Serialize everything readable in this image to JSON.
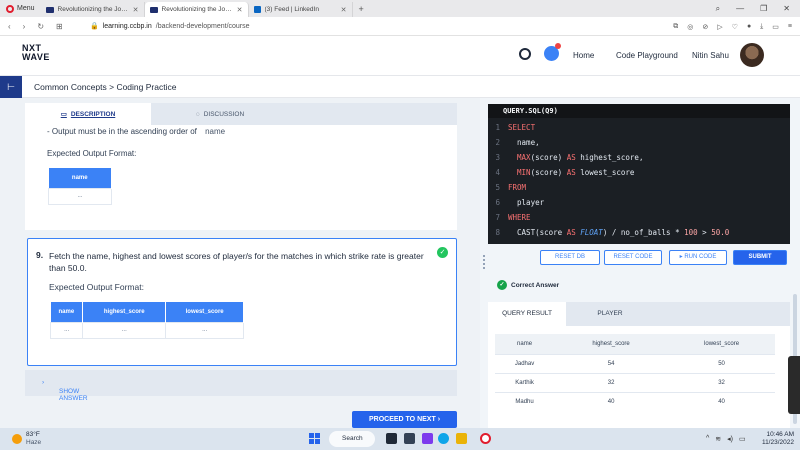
{
  "browser": {
    "menu_label": "Menu",
    "tabs": [
      {
        "title": "Revolutionizing the Job Ma",
        "active": false
      },
      {
        "title": "Revolutionizing the Job Ma",
        "active": true
      },
      {
        "title": "(3) Feed | LinkedIn",
        "active": false
      }
    ],
    "new_tab": "+",
    "url_host": "learning.ccbp.in",
    "url_path": "/backend-development/course"
  },
  "header": {
    "logo_line1": "NXT",
    "logo_line2": "WAVE",
    "nav_home": "Home",
    "nav_playground": "Code Playground",
    "user_name": "Nitin Sahu"
  },
  "breadcrumb": "Common Concepts > Coding Practice",
  "left": {
    "tab_description": "DESCRIPTION",
    "tab_discussion": "DISCUSSION",
    "card1": {
      "bullet": "- Output must be in the ascending order of",
      "bullet_code": "name",
      "expected_label": "Expected Output Format:",
      "columns": [
        "name"
      ],
      "placeholder": "..."
    },
    "card2": {
      "number": "9.",
      "question": "Fetch the name, highest and lowest scores of player/s for the matches in which strike rate is greater than 50.0.",
      "expected_label": "Expected Output Format:",
      "columns": [
        "name",
        "highest_score",
        "lowest_score"
      ],
      "placeholder": "..."
    },
    "show_answer": "SHOW ANSWER",
    "proceed": "PROCEED TO NEXT"
  },
  "editor": {
    "title": "QUERY.SQL(Q9)",
    "lines": [
      {
        "n": "1",
        "code": "SELECT"
      },
      {
        "n": "2",
        "code": "  name,"
      },
      {
        "n": "3",
        "code": "  MAX(score) AS highest_score,"
      },
      {
        "n": "4",
        "code": "  MIN(score) AS lowest_score"
      },
      {
        "n": "5",
        "code": "FROM"
      },
      {
        "n": "6",
        "code": "  player"
      },
      {
        "n": "7",
        "code": "WHERE"
      },
      {
        "n": "8",
        "code": "  CAST(score AS FLOAT) / no_of_balls * 100 > 50.0"
      }
    ]
  },
  "actions": {
    "reset_db": "RESET DB",
    "reset_code": "RESET CODE",
    "run_code": "RUN CODE",
    "submit": "SUBMIT"
  },
  "result": {
    "status": "Correct Answer",
    "tab_query_result": "QUERY RESULT",
    "tab_player": "PLAYER",
    "columns": [
      "name",
      "highest_score",
      "lowest_score"
    ],
    "rows": [
      [
        "Jadhav",
        "54",
        "50"
      ],
      [
        "Karthik",
        "32",
        "32"
      ],
      [
        "Madhu",
        "40",
        "40"
      ]
    ]
  },
  "taskbar": {
    "temperature": "83°F",
    "condition": "Haze",
    "search": "Search",
    "time": "10:46 AM",
    "date": "11/23/2022"
  }
}
